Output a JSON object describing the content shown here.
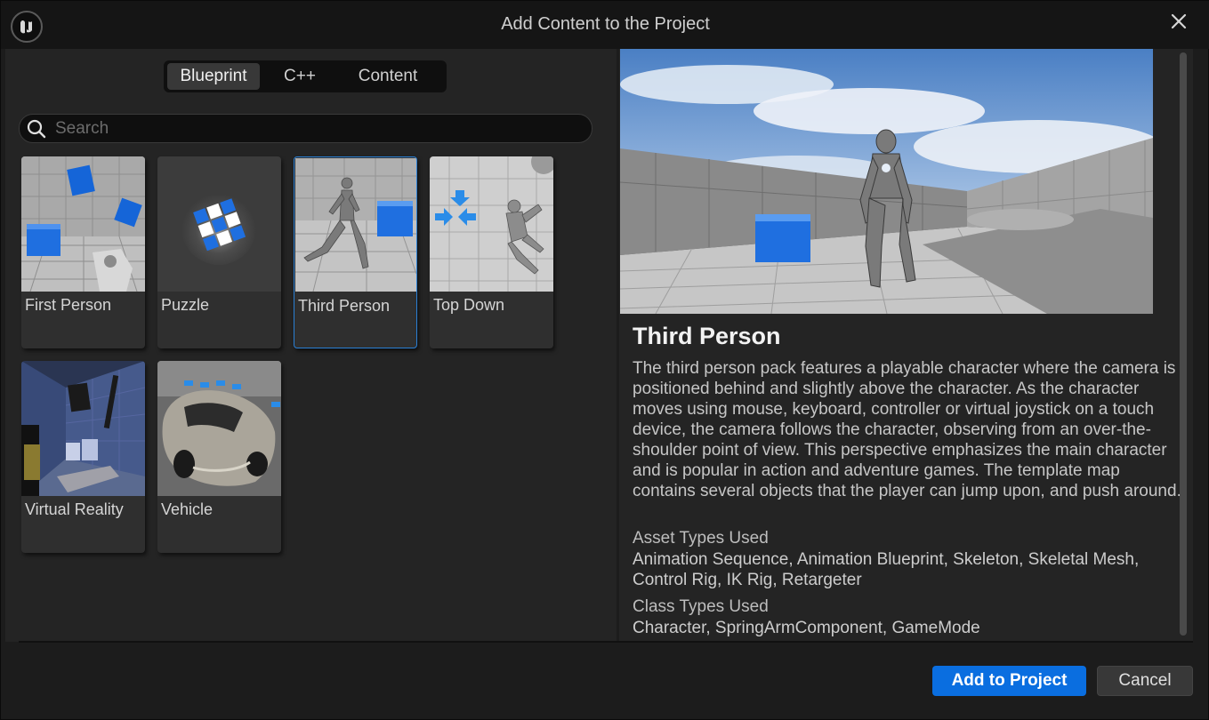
{
  "window": {
    "title": "Add Content to the Project"
  },
  "tabs": [
    {
      "label": "Blueprint",
      "active": true
    },
    {
      "label": "C++",
      "active": false
    },
    {
      "label": "Content",
      "active": false
    }
  ],
  "search": {
    "placeholder": "Search",
    "value": ""
  },
  "templates": [
    {
      "label": "First Person",
      "selected": false
    },
    {
      "label": "Puzzle",
      "selected": false
    },
    {
      "label": "Third Person",
      "selected": true
    },
    {
      "label": "Top Down",
      "selected": false
    },
    {
      "label": "Virtual Reality",
      "selected": false
    },
    {
      "label": "Vehicle",
      "selected": false
    }
  ],
  "detail": {
    "title": "Third Person",
    "description": "The third person pack features a playable character where the camera is positioned behind and slightly above the character. As the character moves using mouse, keyboard, controller or virtual joystick on a touch device, the camera follows the character, observing from an over-the-shoulder point of view. This perspective emphasizes the main character and is popular in action and adventure games. The template map contains several objects that the player can jump upon, and push around.",
    "asset_types_heading": "Asset Types Used",
    "asset_types": "Animation Sequence, Animation Blueprint, Skeleton, Skeletal Mesh, Control Rig, IK Rig, Retargeter",
    "class_types_heading": "Class Types Used",
    "class_types": "Character, SpringArmComponent, GameMode"
  },
  "buttons": {
    "add": "Add to Project",
    "cancel": "Cancel"
  },
  "colors": {
    "accent": "#0a6ee0",
    "selection": "#2a7fd4",
    "cube": "#1565d8"
  }
}
